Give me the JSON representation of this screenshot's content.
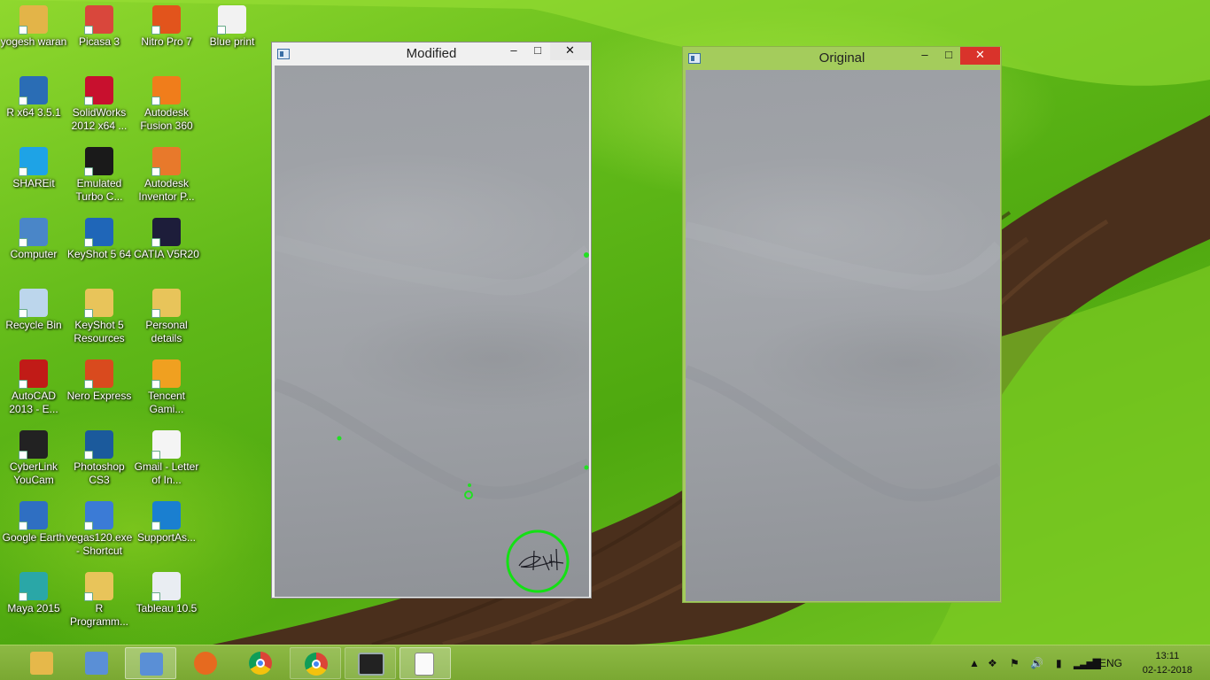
{
  "desktop": {
    "icons": [
      {
        "label": "yogesh waran",
        "icon": "folder-user-icon",
        "color": "#e3b448"
      },
      {
        "label": "Picasa 3",
        "icon": "picasa-icon",
        "color": "#d9473c"
      },
      {
        "label": "Nitro Pro 7",
        "icon": "nitro-pro-icon",
        "color": "#e2541c"
      },
      {
        "label": "Blue print",
        "icon": "document-icon",
        "color": "#f2f2f2"
      },
      {
        "label": "R x64 3.5.1",
        "icon": "r-language-icon",
        "color": "#2a6db5"
      },
      {
        "label": "SolidWorks 2012 x64 ...",
        "icon": "solidworks-icon",
        "color": "#c8102e"
      },
      {
        "label": "Autodesk Fusion 360",
        "icon": "fusion360-icon",
        "color": "#f07d1b"
      },
      {
        "label": "SHAREit",
        "icon": "shareit-icon",
        "color": "#1ea3e6"
      },
      {
        "label": "Emulated Turbo C...",
        "icon": "turbo-c-icon",
        "color": "#1a1a1a"
      },
      {
        "label": "Autodesk Inventor P...",
        "icon": "inventor-icon",
        "color": "#e8792b"
      },
      {
        "label": "Computer",
        "icon": "computer-icon",
        "color": "#4a86c8"
      },
      {
        "label": "KeyShot 5 64",
        "icon": "keyshot-icon",
        "color": "#1f66b8"
      },
      {
        "label": "CATIA V5R20",
        "icon": "catia-icon",
        "color": "#1d1d3a"
      },
      {
        "label": "Recycle Bin",
        "icon": "recycle-bin-icon",
        "color": "#bcd6ec"
      },
      {
        "label": "KeyShot 5 Resources",
        "icon": "folder-icon",
        "color": "#e8c45a"
      },
      {
        "label": "Personal details",
        "icon": "folder-icon",
        "color": "#e8c45a"
      },
      {
        "label": "AutoCAD 2013 - E...",
        "icon": "autocad-icon",
        "color": "#c11b17"
      },
      {
        "label": "Nero Express",
        "icon": "nero-icon",
        "color": "#d94a1e"
      },
      {
        "label": "Tencent Gami...",
        "icon": "tencent-gaming-icon",
        "color": "#f0a020"
      },
      {
        "label": "CyberLink YouCam",
        "icon": "youcam-icon",
        "color": "#222222"
      },
      {
        "label": "Photoshop CS3",
        "icon": "photoshop-icon",
        "color": "#1b5a9c"
      },
      {
        "label": "Gmail - Letter of In...",
        "icon": "pdf-icon",
        "color": "#f4f4f4"
      },
      {
        "label": "Google Earth",
        "icon": "google-earth-icon",
        "color": "#2f6fc2"
      },
      {
        "label": "vegas120.exe - Shortcut",
        "icon": "vegas-icon",
        "color": "#3b7bd6"
      },
      {
        "label": "SupportAs...",
        "icon": "support-assist-icon",
        "color": "#1a7fd0"
      },
      {
        "label": "Maya 2015",
        "icon": "maya-icon",
        "color": "#2aa7a7"
      },
      {
        "label": "R Programm...",
        "icon": "folder-icon",
        "color": "#e8c45a"
      },
      {
        "label": "Tableau 10.5",
        "icon": "tableau-icon",
        "color": "#e9edf2"
      }
    ]
  },
  "windows": {
    "modified": {
      "title": "Modified",
      "minimize": "–",
      "maximize": "□",
      "close": "✕"
    },
    "original": {
      "title": "Original",
      "minimize": "–",
      "maximize": "□",
      "close": "✕",
      "close_color": "#d9332b",
      "frame_color": "#a4cc5c"
    }
  },
  "taskbar": {
    "apps": [
      {
        "name": "file-explorer",
        "icon": "file-explorer-icon",
        "state": "none"
      },
      {
        "name": "app-2",
        "icon": "app-icon",
        "state": "none"
      },
      {
        "name": "app-3",
        "icon": "app-icon",
        "state": "active"
      },
      {
        "name": "firefox",
        "icon": "firefox-icon",
        "state": "none"
      },
      {
        "name": "chrome-1",
        "icon": "chrome-icon",
        "state": "none"
      },
      {
        "name": "chrome-2",
        "icon": "chrome-icon",
        "state": "open"
      },
      {
        "name": "command-prompt",
        "icon": "cmd-icon",
        "state": "open"
      },
      {
        "name": "notepad",
        "icon": "notepad-icon",
        "state": "active"
      }
    ],
    "tray": {
      "language": "ENG",
      "time": "13:11",
      "date": "02-12-2018"
    }
  }
}
